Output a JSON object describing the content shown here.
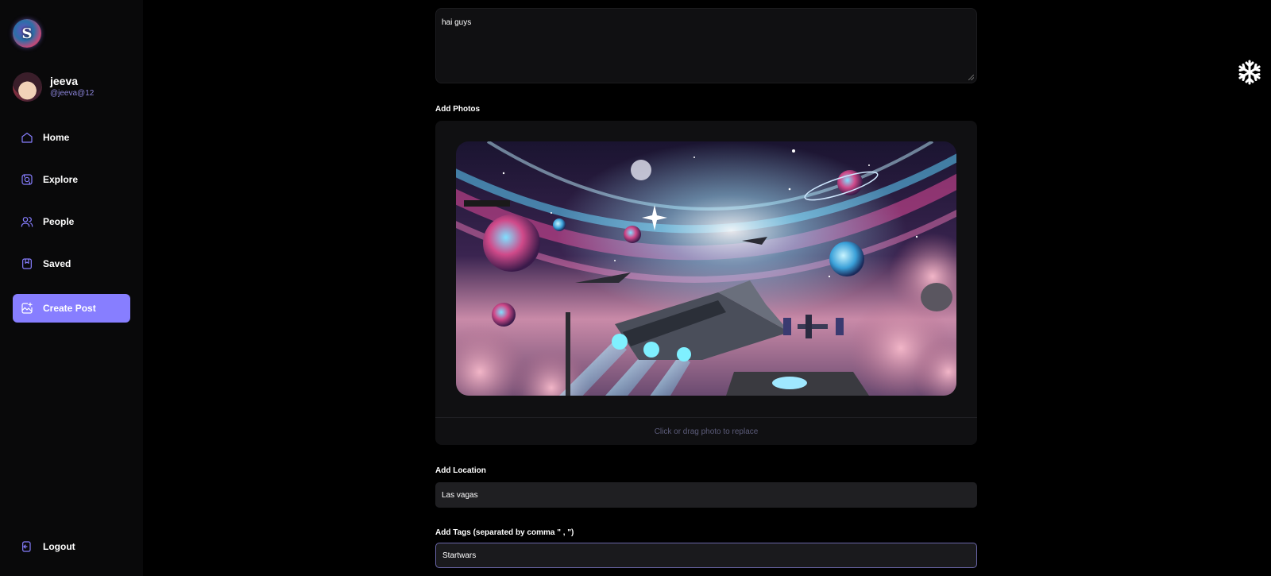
{
  "sidebar": {
    "logo_letter": "S",
    "profile": {
      "name": "jeeva",
      "handle": "@jeeva@12"
    },
    "nav": [
      {
        "label": "Home",
        "icon": "home-icon"
      },
      {
        "label": "Explore",
        "icon": "explore-icon"
      },
      {
        "label": "People",
        "icon": "people-icon"
      },
      {
        "label": "Saved",
        "icon": "bookmark-icon"
      },
      {
        "label": "Create Post",
        "icon": "create-post-icon",
        "active": true
      }
    ],
    "logout_label": "Logout",
    "accent_color": "#877eff"
  },
  "form": {
    "caption_value": "hai guys",
    "photos_label": "Add Photos",
    "photo_hint": "Click or drag photo to replace",
    "location_label": "Add Location",
    "location_value": "Las vagas",
    "tags_label": "Add Tags (separated by comma \" , \")",
    "tags_value": "Startwars"
  },
  "floating_icon": "snowflake-icon"
}
